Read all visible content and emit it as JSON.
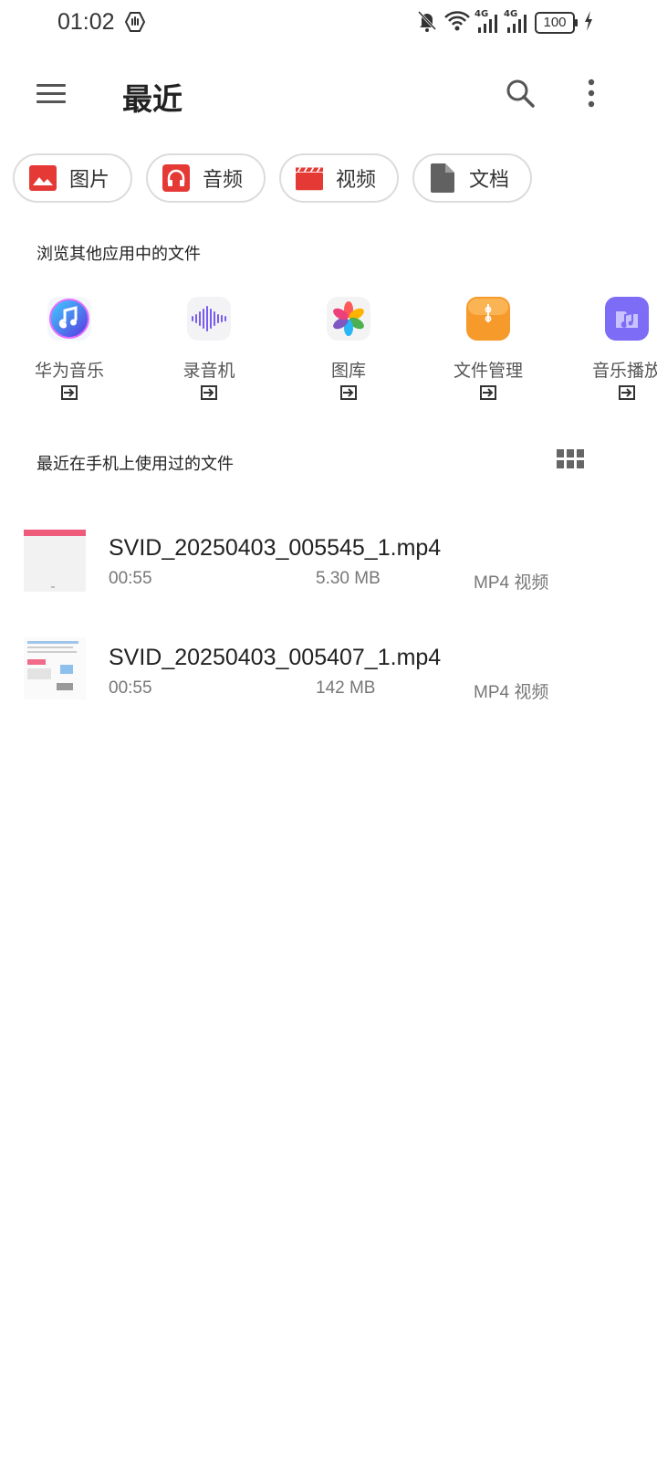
{
  "status_bar": {
    "time": "01:02",
    "battery": "100",
    "net1": "4G",
    "net2": "4G"
  },
  "header": {
    "title": "最近"
  },
  "chips": [
    {
      "label": "图片",
      "icon": "image-icon",
      "color": "#e53935"
    },
    {
      "label": "音频",
      "icon": "headphones-icon",
      "color": "#e53935"
    },
    {
      "label": "视频",
      "icon": "clapperboard-icon",
      "color": "#e53935"
    },
    {
      "label": "文档",
      "icon": "document-icon",
      "color": "#616161"
    }
  ],
  "browse_section": {
    "title": "浏览其他应用中的文件",
    "apps": [
      {
        "label": "华为音乐",
        "icon": "music-note-icon"
      },
      {
        "label": "录音机",
        "icon": "sound-wave-icon"
      },
      {
        "label": "图库",
        "icon": "gallery-pinwheel-icon"
      },
      {
        "label": "文件管理",
        "icon": "folder-icon"
      },
      {
        "label": "音乐播放",
        "icon": "music-folder-icon"
      }
    ]
  },
  "recent_section": {
    "title": "最近在手机上使用过的文件"
  },
  "files": [
    {
      "name": "SVID_20250403_005545_1.mp4",
      "duration": "00:55",
      "size": "5.30 MB",
      "type": "MP4 视频"
    },
    {
      "name": "SVID_20250403_005407_1.mp4",
      "duration": "00:55",
      "size": "142 MB",
      "type": "MP4 视频"
    }
  ]
}
